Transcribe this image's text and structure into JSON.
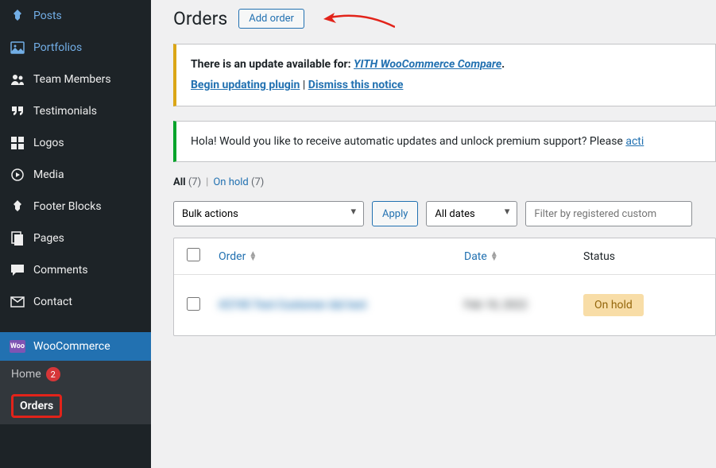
{
  "sidebar": {
    "items": [
      {
        "label": "Posts",
        "icon": "pin"
      },
      {
        "label": "Portfolios",
        "icon": "image"
      },
      {
        "label": "Team Members",
        "icon": "users"
      },
      {
        "label": "Testimonials",
        "icon": "quote"
      },
      {
        "label": "Logos",
        "icon": "grid"
      },
      {
        "label": "Media",
        "icon": "media"
      },
      {
        "label": "Footer Blocks",
        "icon": "pin"
      },
      {
        "label": "Pages",
        "icon": "pages"
      },
      {
        "label": "Comments",
        "icon": "comment"
      },
      {
        "label": "Contact",
        "icon": "mail"
      }
    ],
    "current_parent": "WooCommerce",
    "woo_label": "Woo",
    "submenu": {
      "home": {
        "label": "Home",
        "badge": "2"
      },
      "orders": {
        "label": "Orders"
      }
    }
  },
  "header": {
    "title": "Orders",
    "add": "Add order"
  },
  "notice1": {
    "lead": "There is an update available for: ",
    "plugin": "YITH WooCommerce Compare",
    "begin": "Begin updating plugin",
    "sep": " | ",
    "dismiss": "Dismiss this notice"
  },
  "notice2": {
    "text": "Hola! Would you like to receive automatic updates and unlock premium support? Please ",
    "link": "acti"
  },
  "filters": {
    "all": "All",
    "all_count": "(7)",
    "onhold": "On hold",
    "onhold_count": "(7)"
  },
  "controls": {
    "bulk": "Bulk actions",
    "apply": "Apply",
    "dates": "All dates",
    "search_ph": "Filter by registered custom"
  },
  "table": {
    "cols": {
      "order": "Order",
      "date": "Date",
      "status": "Status"
    },
    "row": {
      "order": "#2745 Test Customer dul test",
      "date": "Feb 18, 2022",
      "status": "On hold"
    }
  }
}
